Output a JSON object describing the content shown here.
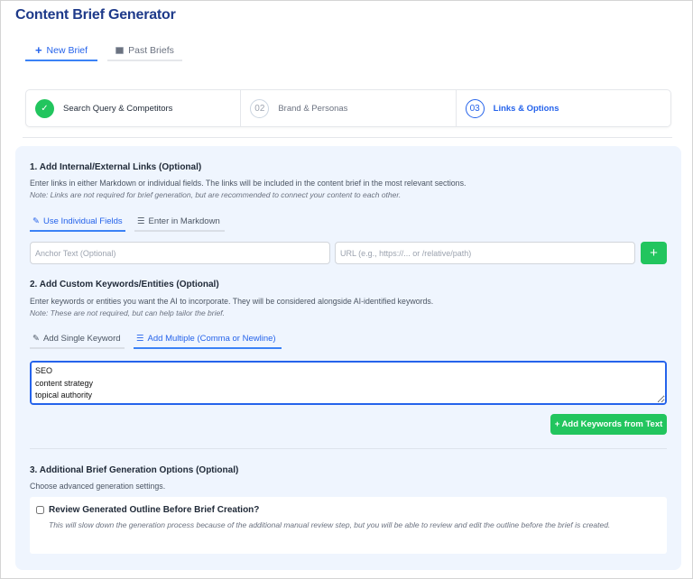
{
  "app": {
    "title": "Content Brief Generator"
  },
  "tabs": [
    {
      "label": "New Brief",
      "icon": "plus-icon"
    },
    {
      "label": "Past Briefs",
      "icon": "archive-icon"
    }
  ],
  "stepper": [
    {
      "number": "✓",
      "label": "Search Query & Competitors",
      "state": "complete"
    },
    {
      "number": "02",
      "label": "Brand & Personas",
      "state": "pending"
    },
    {
      "number": "03",
      "label": "Links & Options",
      "state": "active"
    }
  ],
  "section1": {
    "heading": "1. Add Internal/External Links (Optional)",
    "description": "Enter links in either Markdown or individual fields. The links will be included in the content brief in the most relevant sections.",
    "note": "Note: Links are not required for brief generation, but are recommended to connect your content to each other.",
    "tabs": [
      {
        "label": "Use Individual Fields"
      },
      {
        "label": "Enter in Markdown"
      }
    ],
    "anchor_placeholder": "Anchor Text (Optional)",
    "url_placeholder": "URL (e.g., https://... or /relative/path)",
    "add_label": "+"
  },
  "section2": {
    "heading": "2. Add Custom Keywords/Entities (Optional)",
    "description": "Enter keywords or entities you want the AI to incorporate. They will be considered alongside AI-identified keywords.",
    "note": "Note: These are not required, but can help tailor the brief.",
    "tabs": [
      {
        "label": "Add Single Keyword"
      },
      {
        "label": "Add Multiple (Comma or Newline)"
      }
    ],
    "textarea_value": "SEO\ncontent strategy\ntopical authority",
    "add_button": "+ Add Keywords from Text"
  },
  "section3": {
    "heading": "3. Additional Brief Generation Options (Optional)",
    "description": "Choose advanced generation settings.",
    "option": {
      "label": "Review Generated Outline Before Brief Creation?",
      "help": "This will slow down the generation process because of the additional manual review step, but you will be able to review and edit the outline before the brief is created.",
      "checked": false
    }
  },
  "colors": {
    "accent": "#2563eb",
    "success": "#22c55e",
    "title": "#1e3a8a",
    "panel": "#eff5fe"
  }
}
